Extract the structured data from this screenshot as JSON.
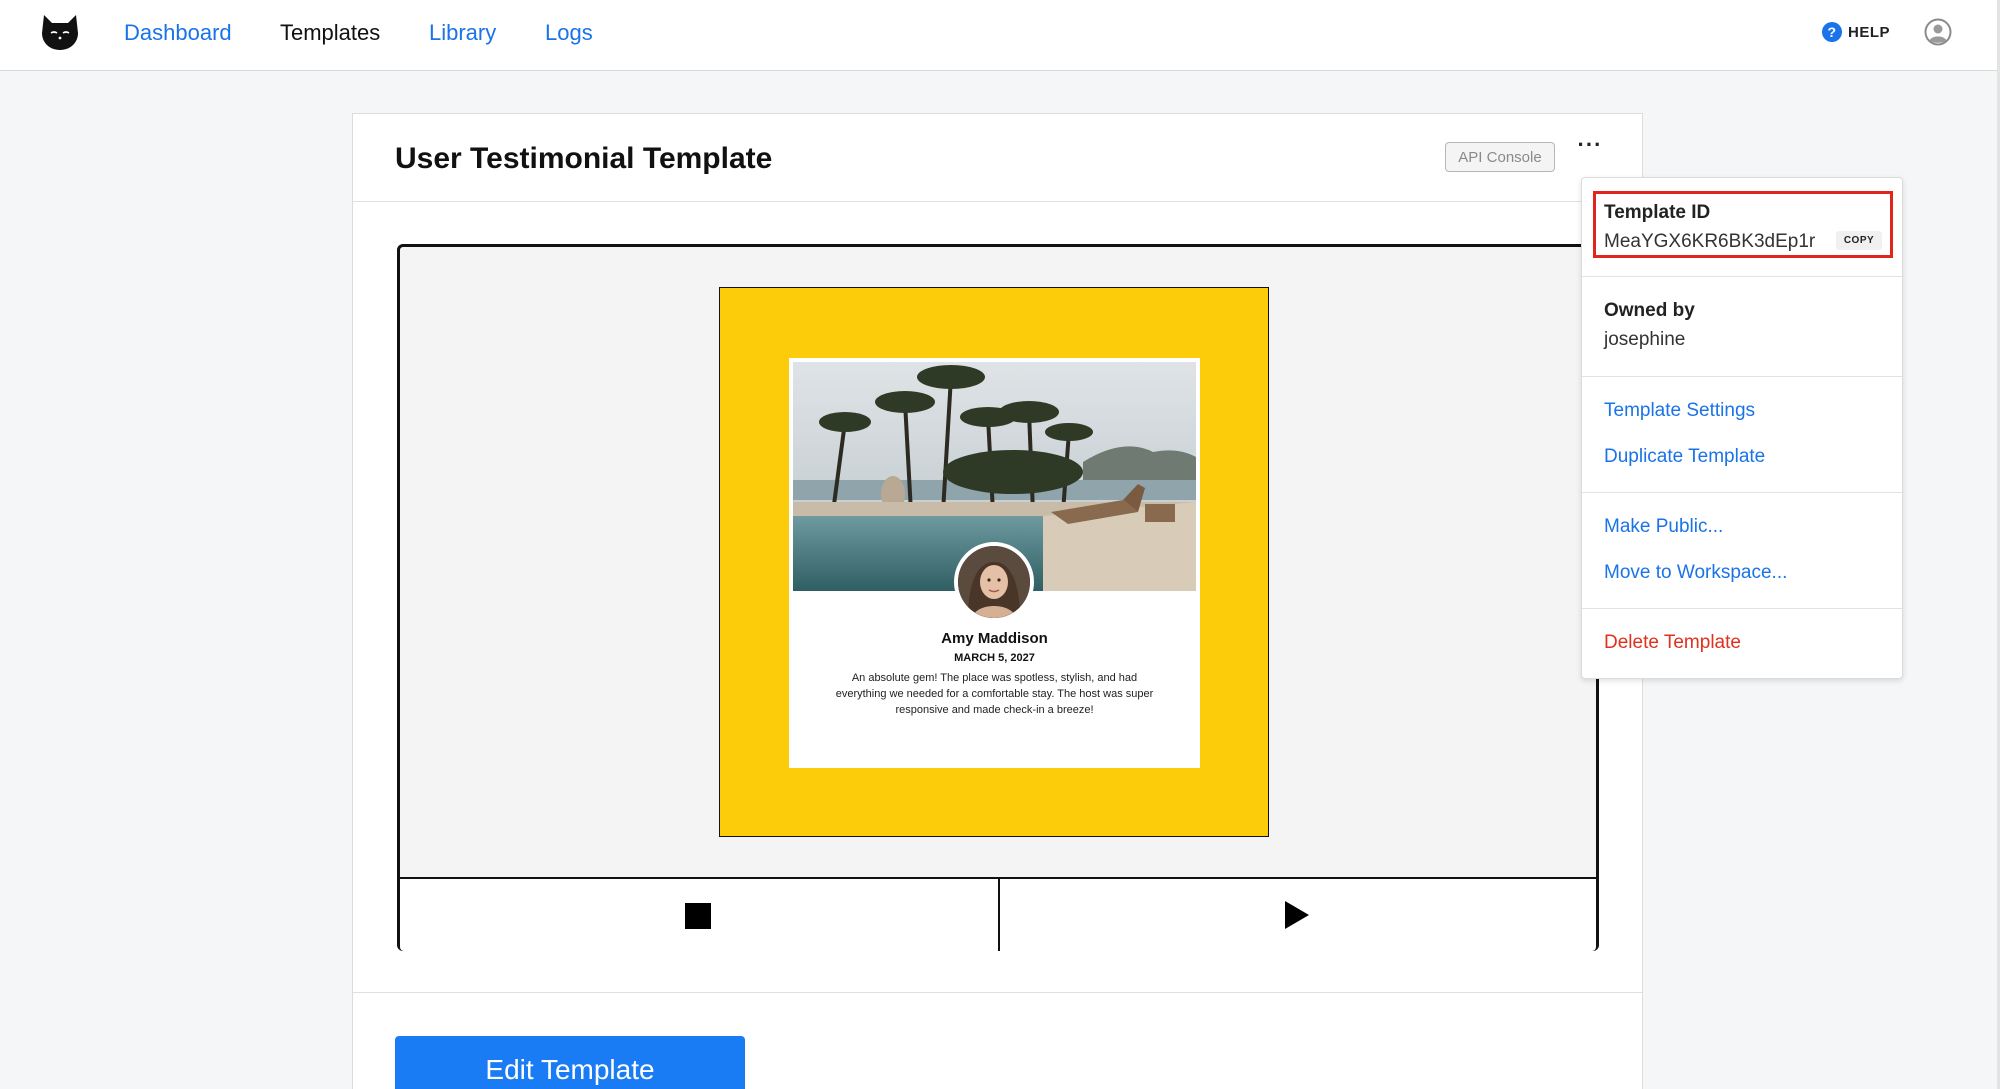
{
  "nav": {
    "items": [
      {
        "label": "Dashboard",
        "active": false
      },
      {
        "label": "Templates",
        "active": true
      },
      {
        "label": "Library",
        "active": false
      },
      {
        "label": "Logs",
        "active": false
      }
    ],
    "help_label": "HELP"
  },
  "card": {
    "title": "User Testimonial Template",
    "api_console_label": "API Console",
    "more_label": "···",
    "edit_label": "Edit Template"
  },
  "testimonial": {
    "name": "Amy Maddison",
    "date": "MARCH 5, 2027",
    "body": "An absolute gem! The place was spotless, stylish, and had everything we needed for a comfortable stay. The host was super responsive and made check-in a breeze!",
    "background_color": "#fccc0b"
  },
  "menu": {
    "template_id_label": "Template ID",
    "template_id_value": "MeaYGX6KR6BK3dEp1r",
    "copy_label": "COPY",
    "owned_by_label": "Owned by",
    "owner": "josephine",
    "settings_label": "Template Settings",
    "duplicate_label": "Duplicate Template",
    "make_public_label": "Make Public...",
    "move_label": "Move to Workspace...",
    "delete_label": "Delete Template"
  },
  "colors": {
    "link": "#1a73e8",
    "primary_button": "#1a7cf5",
    "danger": "#e0301e",
    "highlight_border": "#e1251b"
  },
  "icons": {
    "logo": "cat-logo-icon",
    "help": "question-circle-icon",
    "account": "user-circle-icon",
    "stop": "stop-icon",
    "play": "play-icon"
  }
}
